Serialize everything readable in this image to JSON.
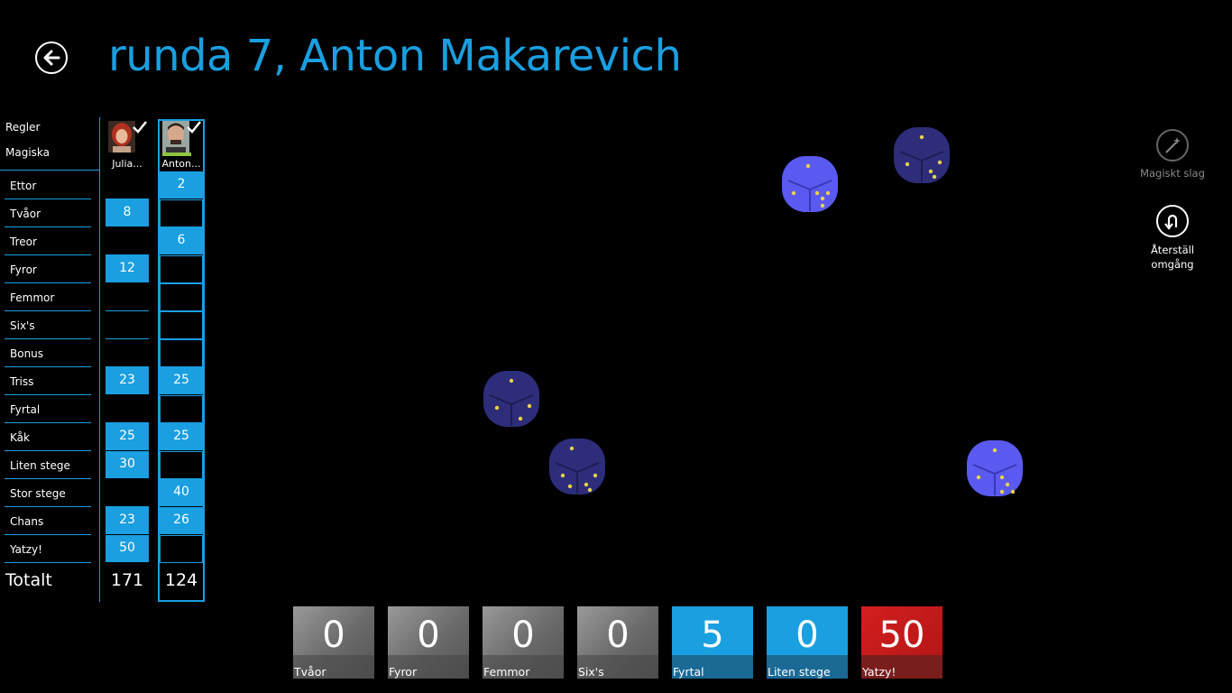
{
  "header": {
    "title": "runda 7, Anton Makarevich"
  },
  "menu": {
    "rules": "Regler",
    "magic": "Magiska"
  },
  "categories": [
    "Ettor",
    "Tvåor",
    "Treor",
    "Fyror",
    "Femmor",
    "Six's",
    "Bonus",
    "Triss",
    "Fyrtal",
    "Kåk",
    "Liten stege",
    "Stor stege",
    "Chans",
    "Yatzy!"
  ],
  "total_label": "Totalt",
  "players": [
    {
      "name": "Julia...",
      "scores": [
        "",
        "8",
        "",
        "12",
        "",
        "",
        "",
        "23",
        "",
        "25",
        "30",
        "",
        "23",
        "50"
      ],
      "total": "171"
    },
    {
      "name": "Anton...",
      "scores": [
        "2",
        "",
        "6",
        "",
        "",
        "",
        "",
        "25",
        "",
        "25",
        "",
        "40",
        "26",
        ""
      ],
      "total": "124"
    }
  ],
  "side": {
    "magic_roll": "Magiskt slag",
    "reset_round": "Återställ omgång"
  },
  "tiles": [
    {
      "value": "0",
      "label": "Tvåor",
      "style": "gray"
    },
    {
      "value": "0",
      "label": "Fyror",
      "style": "gray"
    },
    {
      "value": "0",
      "label": "Femmor",
      "style": "gray"
    },
    {
      "value": "0",
      "label": "Six's",
      "style": "gray"
    },
    {
      "value": "5",
      "label": "Fyrtal",
      "style": "blue"
    },
    {
      "value": "0",
      "label": "Liten stege",
      "style": "blue"
    },
    {
      "value": "50",
      "label": "Yatzy!",
      "style": "red"
    }
  ],
  "dice": [
    {
      "name": "die-1",
      "held": false
    },
    {
      "name": "die-2",
      "held": true
    },
    {
      "name": "die-3",
      "held": true
    },
    {
      "name": "die-4",
      "held": true
    },
    {
      "name": "die-5",
      "held": false
    }
  ],
  "colors": {
    "accent": "#1a9fe0",
    "die_free": "#5a5af0",
    "die_held": "#2d2d7a",
    "pip": "#e8d24a",
    "tile_red": "#c81a1a"
  }
}
